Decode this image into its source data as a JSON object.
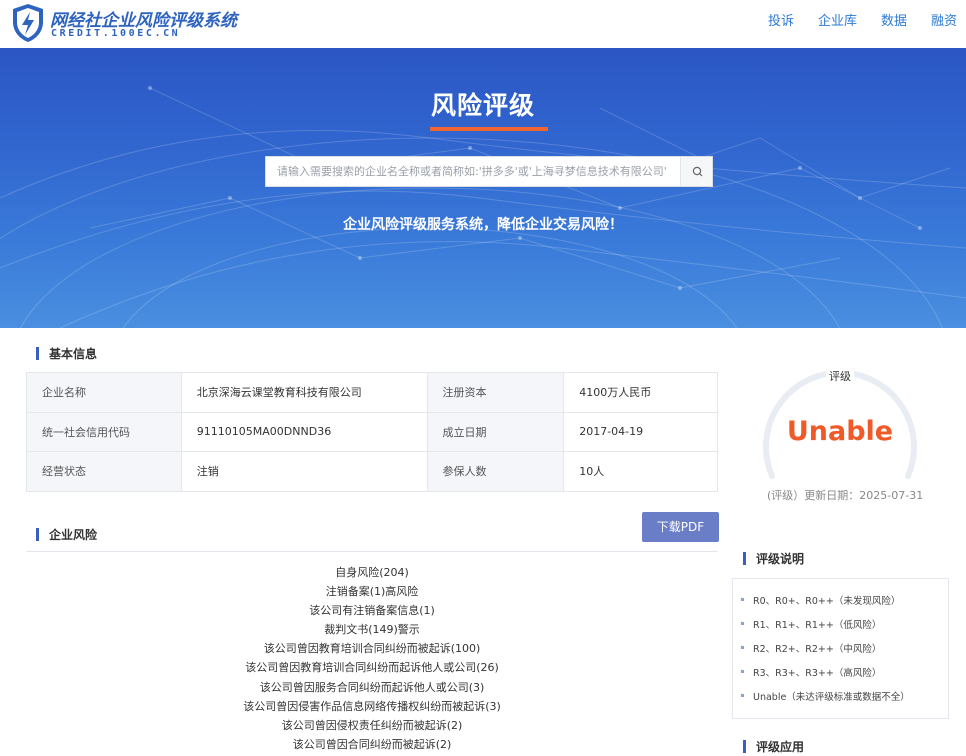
{
  "header": {
    "logo_title": "网经社企业风险评级系统",
    "logo_sub": "CREDIT.100EC.CN",
    "nav": [
      "投诉",
      "企业库",
      "数据",
      "融资"
    ]
  },
  "banner": {
    "title": "风险评级",
    "search_placeholder": "请输入需要搜索的企业名全称或者简称如:'拼多多'或'上海寻梦信息技术有限公司'",
    "slogan": "企业风险评级服务系统，降低企业交易风险！"
  },
  "basic_info": {
    "title": "基本信息",
    "rows": [
      [
        "企业名称",
        "北京深海云课堂教育科技有限公司",
        "注册资本",
        "4100万人民币"
      ],
      [
        "统一社会信用代码",
        "91110105MA00DNND36",
        "成立日期",
        "2017-04-19"
      ],
      [
        "经营状态",
        "注销",
        "参保人数",
        "10人"
      ]
    ]
  },
  "rating": {
    "label": "评级",
    "value": "Unable",
    "date_text": "(评级）更新日期：2025-07-31",
    "value_color": "#f05a28"
  },
  "risk": {
    "title": "企业风险",
    "download_label": "下载PDF",
    "items": [
      "自身风险(204)",
      "注销备案(1)高风险",
      "该公司有注销备案信息(1)",
      "裁判文书(149)警示",
      "该公司曾因教育培训合同纠纷而被起诉(100)",
      "该公司曾因教育培训合同纠纷而起诉他人或公司(26)",
      "该公司曾因服务合同纠纷而起诉他人或公司(3)",
      "该公司曾因侵害作品信息网络传播权纠纷而被起诉(3)",
      "该公司曾因侵权责任纠纷而被起诉(2)",
      "该公司曾因合同纠纷而被起诉(2)"
    ]
  },
  "rating_explain": {
    "title": "评级说明",
    "items": [
      "R0、R0+、R0++（未发现风险）",
      "R1、R1+、R1++（低风险）",
      "R2、R2+、R2++（中风险）",
      "R3、R3+、R3++（高风险）",
      "Unable（未达评级标准或数据不全）"
    ]
  },
  "rating_apply": {
    "title": "评级应用"
  },
  "colors": {
    "brand": "#2e64c0",
    "accent": "#f2652f",
    "button": "#6a7ec7"
  }
}
